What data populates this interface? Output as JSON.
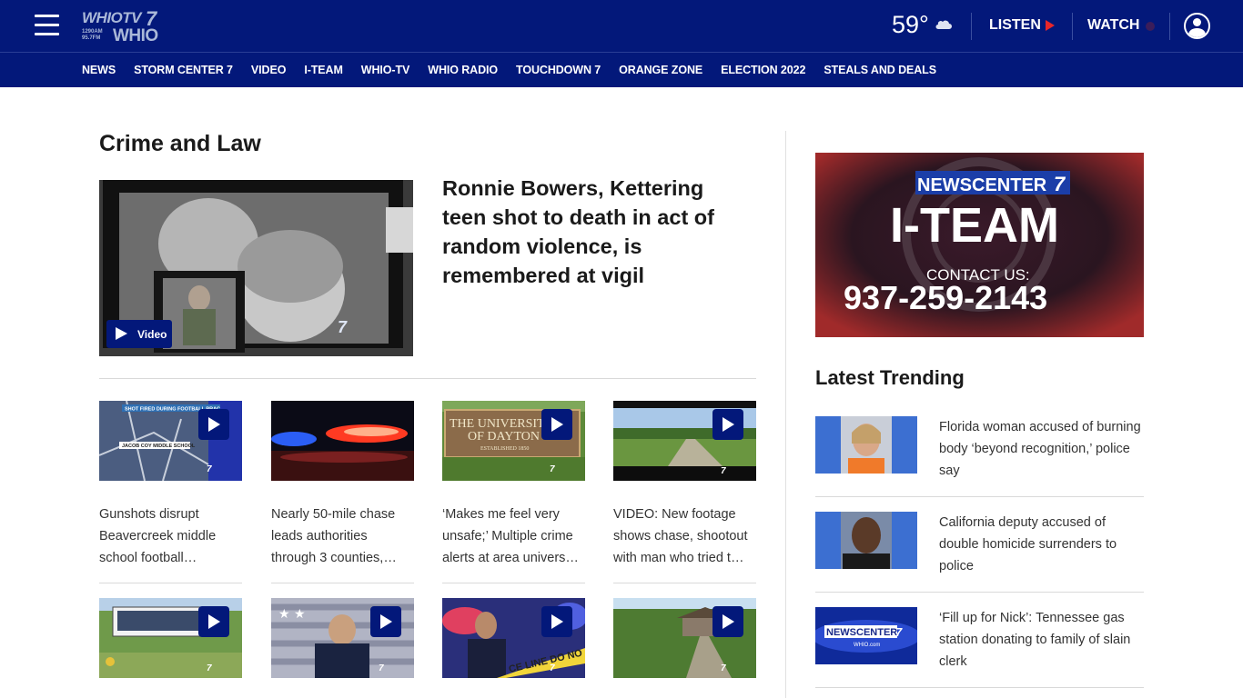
{
  "header": {
    "logo_top": "WHIOTV",
    "logo_seven": "7",
    "logo_freq": "1290AM\n95.7FM",
    "logo_bottom": "WHIO",
    "temperature": "59°",
    "weather_icon": "cloud-icon",
    "listen_label": "LISTEN",
    "watch_label": "WATCH"
  },
  "nav": {
    "items": [
      "NEWS",
      "STORM CENTER 7",
      "VIDEO",
      "I-TEAM",
      "WHIO-TV",
      "WHIO RADIO",
      "TOUCHDOWN 7",
      "ORANGE ZONE",
      "ELECTION 2022",
      "STEALS AND DEALS"
    ]
  },
  "main": {
    "section_title": "Crime and Law",
    "lead": {
      "headline": "Ronnie Bowers, Kettering teen shot to death in act of random violence, is remembered at vigil",
      "video_label": "Video"
    },
    "cards": [
      {
        "title": "Gunshots disrupt Beavercreek middle school football…",
        "thumb_text_1": "SHOT FIRED DURING FOOTBALL PRAC",
        "thumb_text_2": "JACOB COY MIDDLE SCHOOL"
      },
      {
        "title": "Nearly 50-mile chase leads authorities through 3 counties,…"
      },
      {
        "title": "‘Makes me feel very unsafe;’ Multiple crime alerts at area univers…",
        "thumb_text_1": "THE UNIVERSITY",
        "thumb_text_2": "OF DAYTON",
        "thumb_text_3": "ESTABLISHED 1850"
      },
      {
        "title": "VIDEO: New footage shows chase, shootout with man who tried t…"
      },
      {
        "title": ""
      },
      {
        "title": ""
      },
      {
        "title": "",
        "thumb_text_1": "CE LINE DO NO"
      },
      {
        "title": ""
      }
    ]
  },
  "sidebar": {
    "ad": {
      "brand": "NEWSCENTER",
      "brand_num": "7",
      "team": "I-TEAM",
      "contact": "CONTACT US:",
      "phone": "937-259-2143"
    },
    "trending_title": "Latest Trending",
    "trending": [
      {
        "title": "Florida woman accused of burning body ‘beyond recognition,’ police say"
      },
      {
        "title": "California deputy accused of double homicide surrenders to police"
      },
      {
        "title": "‘Fill up for Nick’: Tennessee gas station donating to family of slain clerk",
        "thumb_brand": "NEWSCENTER",
        "thumb_num": "7",
        "thumb_sub": "WHIO.com"
      }
    ]
  }
}
